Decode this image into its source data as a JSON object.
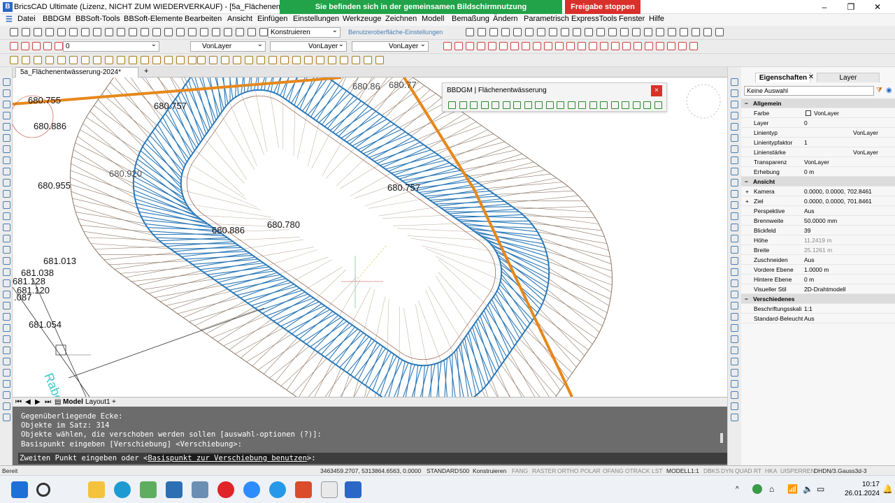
{
  "window": {
    "title": "BricsCAD Ultimate (Lizenz, NICHT ZUM WIEDERVERKAUF) - [5a_Flächenentwässerung-2",
    "share_notice": "Sie befinden sich in der gemeinsamen Bildschirmnutzung",
    "stop_share": "Freigabe stoppen",
    "controls": [
      "–",
      "❐",
      "✕"
    ]
  },
  "menu": [
    "Datei",
    "BBDGM",
    "BBSoft-Tools",
    "BBSoft-Elemente",
    "Bearbeiten",
    "Ansicht",
    "Einfügen",
    "Einstellungen",
    "Werkzeuge",
    "Zeichnen",
    "Modell",
    "Bemaßung",
    "Ändern",
    "Parametrisch",
    "ExpressTools",
    "Fenster",
    "Hilfe"
  ],
  "toolbar": {
    "workspace": "Konstruieren",
    "ui_settings": "Benutzeroberfläche-Einstellungen",
    "layer_combo": "0",
    "color_combo": "VonLayer",
    "linetype_combo": "VonLayer",
    "lineweight_combo": "VonLayer"
  },
  "doc_tab": "5a_Flächenentwässerung-2024*",
  "doc_tab_add": "+",
  "canvas": {
    "labels": [
      "680.755",
      "680.886",
      "680.757",
      "680.920",
      "680.955",
      "680.757",
      "680.886",
      "680.780",
      "681.013",
      "681.038",
      "681.128",
      "681.120",
      ".087",
      "681.054",
      "680.86",
      "680.77",
      "Rabe"
    ]
  },
  "bbdgm_panel": {
    "title": "BBDGM | Flächenentwässerung",
    "close": "×"
  },
  "layout_tabs": {
    "model": "Model",
    "layout1": "Layout1",
    "add": "+"
  },
  "command": {
    "history": [
      "Gegenüberliegende Ecke:",
      "Objekte im Satz: 314",
      "Objekte wählen, die verschoben werden sollen [auswahl-optionen (?)]:",
      "Basispunkt eingeben [Verschiebung] <Verschiebung>:"
    ],
    "prompt_pre": "Zweiten Punkt eingeben oder <",
    "prompt_hl": "Basispunkt zur Verschiebung benutzen",
    "prompt_post": ">:"
  },
  "status": {
    "ready": "Bereit",
    "coords": "3463459.2707, 5313864.6563, 0.0000",
    "items": [
      "STANDARD",
      "500",
      "Konstruieren",
      "FANG",
      "RASTER",
      "ORTHO",
      "POLAR",
      "OFANG",
      "OTRACK",
      "LST",
      "MODELL",
      "1:1",
      "DBKS",
      "DYN",
      "QUAD",
      "RT",
      "HKA",
      "UISPERREN",
      "DHDN/3.Gauss3d-3"
    ]
  },
  "properties": {
    "tab1": "Eigenschaften",
    "tab1_close": "✕",
    "tab2": "Layer",
    "selection": "Keine Auswahl",
    "sections": [
      {
        "name": "Allgemein",
        "rows": [
          {
            "k": "Farbe",
            "v": "VonLayer"
          },
          {
            "k": "Layer",
            "v": "0"
          },
          {
            "k": "Linientyp",
            "v": "VonLayer"
          },
          {
            "k": "Linientypfaktor",
            "v": "1"
          },
          {
            "k": "Linienstärke",
            "v": "VonLayer"
          },
          {
            "k": "Transparenz",
            "v": "VonLayer"
          },
          {
            "k": "Erhebung",
            "v": "0 m"
          }
        ]
      },
      {
        "name": "Ansicht",
        "rows": [
          {
            "k": "Kamera",
            "v": "0.0000, 0.0000, 702.8461"
          },
          {
            "k": "Ziel",
            "v": "0.0000, 0.0000, 701.8461"
          },
          {
            "k": "Perspektive",
            "v": "Aus"
          },
          {
            "k": "Brennweite",
            "v": "50.0000 mm"
          },
          {
            "k": "Blickfeld",
            "v": "39"
          },
          {
            "k": "Höhe",
            "v": "11.2419 m"
          },
          {
            "k": "Breite",
            "v": "25.1261 m"
          },
          {
            "k": "Zuschneiden",
            "v": "Aus"
          },
          {
            "k": "Vordere Ebene",
            "v": "1.0000 m"
          },
          {
            "k": "Hintere Ebene",
            "v": "0 m"
          },
          {
            "k": "Visueller Stil",
            "v": "2D-Drahtmodell"
          }
        ]
      },
      {
        "name": "Verschiedenes",
        "rows": [
          {
            "k": "Beschriftungsskali",
            "v": "1:1"
          },
          {
            "k": "Standard-Beleucht",
            "v": "Aus"
          }
        ]
      }
    ]
  },
  "taskbar": {
    "time": "10:17",
    "date": "26.01.2024"
  },
  "colors": {
    "blue_lines": "#2a78b8",
    "orange_line": "#e6881c",
    "brown_lines": "#8a7462",
    "share_green": "#22a349",
    "stop_red": "#d9302b"
  }
}
